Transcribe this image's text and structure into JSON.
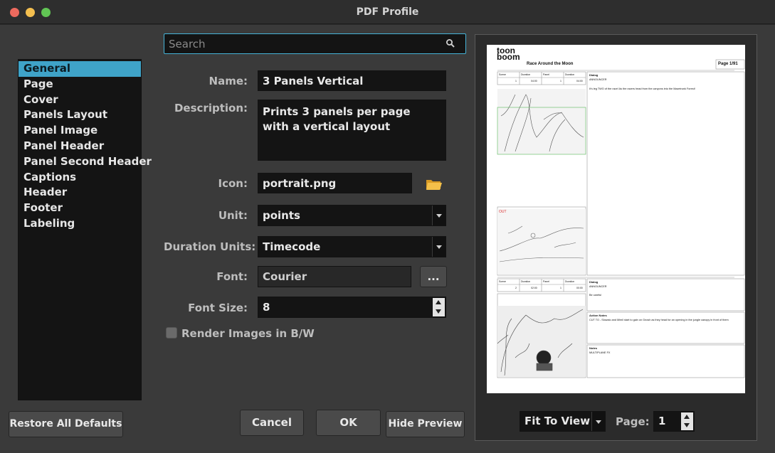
{
  "window": {
    "title": "PDF Profile"
  },
  "search": {
    "placeholder": "Search"
  },
  "sidebar": {
    "items": [
      {
        "label": "General",
        "selected": true
      },
      {
        "label": "Page"
      },
      {
        "label": "Cover"
      },
      {
        "label": "Panels Layout"
      },
      {
        "label": "Panel Image"
      },
      {
        "label": "Panel Header"
      },
      {
        "label": "Panel Second Header"
      },
      {
        "label": "Captions"
      },
      {
        "label": "Header"
      },
      {
        "label": "Footer"
      },
      {
        "label": "Labeling"
      }
    ]
  },
  "form": {
    "name_label": "Name:",
    "name_value": "3 Panels Vertical",
    "description_label": "Description:",
    "description_value": "Prints 3 panels per page with a vertical layout",
    "icon_label": "Icon:",
    "icon_value": "portrait.png",
    "unit_label": "Unit:",
    "unit_value": "points",
    "duration_label": "Duration Units:",
    "duration_value": "Timecode",
    "font_label": "Font:",
    "font_value": "Courier",
    "font_browse": "...",
    "font_size_label": "Font Size:",
    "font_size_value": "8",
    "bw_label": "Render Images in B/W",
    "bw_checked": false
  },
  "buttons": {
    "restore": "Restore All Defaults",
    "cancel": "Cancel",
    "ok": "OK",
    "hide_preview": "Hide Preview"
  },
  "preview": {
    "logo_top": "toon",
    "logo_bottom": "boom",
    "doc_title": "Race Around the Moon",
    "page_indicator": "Page 1/91",
    "panel1": {
      "scene_h": "Scene",
      "duration_h": "Duration",
      "panel_h": "Panel",
      "duration2_h": "Duration",
      "scene": "1",
      "duration": "04:00",
      "panel": "1",
      "duration2": "04:00",
      "dialog_h": "Dialog",
      "dialog_name": "ANNOUNCER",
      "dialog_text": "It's leg TWO of the race! As the racers head from the canyons into the Mazetrunk Forest!"
    },
    "panel2": {
      "caption": "OUT"
    },
    "panel3": {
      "scene_h": "Scene",
      "duration_h": "Duration",
      "panel_h": "Panel",
      "duration2_h": "Duration",
      "scene": "2",
      "duration": "02:00",
      "panel": "1",
      "duration2": "00:00",
      "dialog_h": "Dialog",
      "dialog_name": "ANNOUNCER",
      "dialog_text": "Be careful",
      "action_h": "Action Notes",
      "action_text": "CUT TO - Slowalo and Mimil start to gain on Gnosh as they head for an opening in the jungle canopy in front of them",
      "notes_h": "Notes",
      "notes_text": "MULTIPLANE FX"
    }
  },
  "footer": {
    "zoom_value": "Fit To View",
    "page_label": "Page:",
    "page_value": "1"
  }
}
